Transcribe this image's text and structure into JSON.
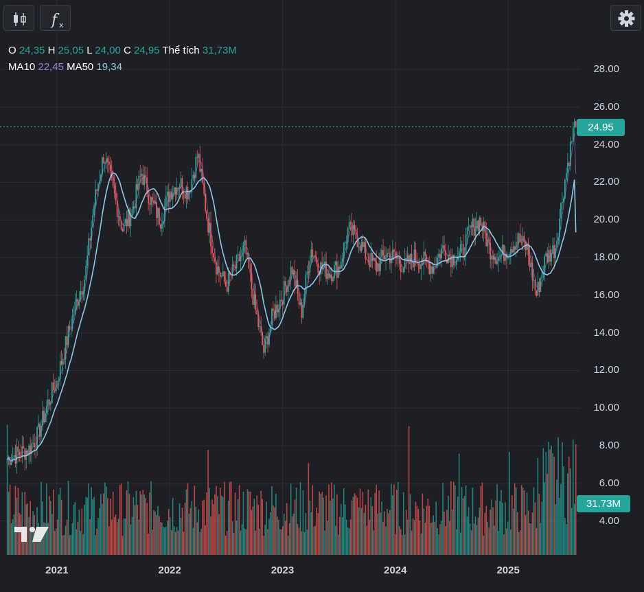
{
  "toolbar": {
    "candles_icon": "candlestick-icon",
    "indicators_icon": "function-icon",
    "indicators_label": "f",
    "settings_icon": "gear-icon"
  },
  "legend": {
    "o_label": "O",
    "o_value": "24,35",
    "h_label": "H",
    "h_value": "25,05",
    "l_label": "L",
    "l_value": "24,00",
    "c_label": "C",
    "c_value": "24,95",
    "vol_label": "Thể tích",
    "vol_value": "31,73M",
    "ma10_label": "MA10",
    "ma10_value": "22,45",
    "ma50_label": "MA50",
    "ma50_value": "19,34"
  },
  "colors": {
    "background": "#1e1f24",
    "up": "#26a69a",
    "down": "#ef5350",
    "ma10": "#9b7cd0",
    "ma50": "#8fc7e8",
    "grid": "#2b2d33"
  },
  "badges": {
    "last_price": "24.95",
    "last_volume": "31.73M"
  },
  "chart_data": {
    "type": "line",
    "x_ticks": [
      "2021",
      "2022",
      "2023",
      "2024",
      "2025"
    ],
    "y_ticks": [
      "28.00",
      "26.00",
      "24.00",
      "22.00",
      "20.00",
      "18.00",
      "16.00",
      "14.00",
      "12.00",
      "10.00",
      "8.00",
      "6.00",
      "4.00"
    ],
    "ylim": [
      2.2,
      29.5
    ],
    "grid": true,
    "price_path": [
      [
        "2020-07",
        7.0
      ],
      [
        "2020-08",
        7.4
      ],
      [
        "2020-09",
        7.6
      ],
      [
        "2020-10",
        7.8
      ],
      [
        "2020-11",
        8.6
      ],
      [
        "2020-12",
        10.2
      ],
      [
        "2021-01",
        11.5
      ],
      [
        "2021-02",
        13.5
      ],
      [
        "2021-03",
        15.5
      ],
      [
        "2021-04",
        17.0
      ],
      [
        "2021-05",
        21.0
      ],
      [
        "2021-06",
        23.5
      ],
      [
        "2021-07",
        21.5
      ],
      [
        "2021-08",
        19.5
      ],
      [
        "2021-09",
        20.5
      ],
      [
        "2021-10",
        22.5
      ],
      [
        "2021-11",
        21.0
      ],
      [
        "2021-12",
        20.0
      ],
      [
        "2022-01",
        21.5
      ],
      [
        "2022-02",
        22.0
      ],
      [
        "2022-03",
        21.5
      ],
      [
        "2022-04",
        23.5
      ],
      [
        "2022-05",
        20.0
      ],
      [
        "2022-06",
        17.5
      ],
      [
        "2022-07",
        16.5
      ],
      [
        "2022-08",
        17.5
      ],
      [
        "2022-09",
        18.5
      ],
      [
        "2022-10",
        15.5
      ],
      [
        "2022-11",
        13.0
      ],
      [
        "2022-12",
        15.0
      ],
      [
        "2023-01",
        16.0
      ],
      [
        "2023-02",
        17.5
      ],
      [
        "2023-03",
        15.0
      ],
      [
        "2023-04",
        18.5
      ],
      [
        "2023-05",
        17.5
      ],
      [
        "2023-06",
        17.2
      ],
      [
        "2023-07",
        17.5
      ],
      [
        "2023-08",
        19.5
      ],
      [
        "2023-09",
        19.0
      ],
      [
        "2023-10",
        18.0
      ],
      [
        "2023-11",
        17.5
      ],
      [
        "2023-12",
        18.2
      ],
      [
        "2024-01",
        18.0
      ],
      [
        "2024-02",
        17.5
      ],
      [
        "2024-03",
        18.0
      ],
      [
        "2024-04",
        17.8
      ],
      [
        "2024-05",
        17.5
      ],
      [
        "2024-06",
        18.5
      ],
      [
        "2024-07",
        18.0
      ],
      [
        "2024-08",
        18.2
      ],
      [
        "2024-09",
        19.5
      ],
      [
        "2024-10",
        20.0
      ],
      [
        "2024-11",
        18.5
      ],
      [
        "2024-12",
        18.0
      ],
      [
        "2025-01",
        18.5
      ],
      [
        "2025-02",
        19.0
      ],
      [
        "2025-03",
        18.5
      ],
      [
        "2025-04",
        16.0
      ],
      [
        "2025-05",
        18.0
      ],
      [
        "2025-06",
        18.5
      ],
      [
        "2025-07",
        22.0
      ],
      [
        "2025-08",
        24.95
      ]
    ],
    "ma10_value": 22.45,
    "ma50_value": 19.34,
    "last_close": 24.95,
    "last_volume": "31.73M"
  }
}
